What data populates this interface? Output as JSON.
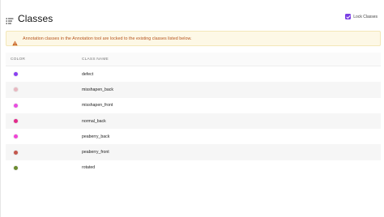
{
  "header": {
    "title": "Classes",
    "lock_label": "Lock Classes",
    "lock_checked": true
  },
  "banner": {
    "text": "Annotation classes in the Annotation tool are locked to the existing classes listed below."
  },
  "table": {
    "columns": [
      "COLOR",
      "CLASS NAME"
    ],
    "rows": [
      {
        "name": "defect",
        "color": "#8a3ff2"
      },
      {
        "name": "misshapen_back",
        "color": "#e8b7c0"
      },
      {
        "name": "misshapen_front",
        "color": "#e84de0"
      },
      {
        "name": "normal_back",
        "color": "#e22a8a"
      },
      {
        "name": "peaberry_back",
        "color": "#f044d6"
      },
      {
        "name": "peaberry_front",
        "color": "#c4574c"
      },
      {
        "name": "rotated",
        "color": "#6a8a2e"
      }
    ]
  },
  "colors": {
    "accent": "#7b3fe4",
    "warning_text": "#b7561f",
    "warning_bg": "#fdf8e6"
  },
  "icons": {
    "title_icon": "list-icon",
    "banner_icon": "warning-icon",
    "checkbox_icon": "checkmark-icon"
  }
}
